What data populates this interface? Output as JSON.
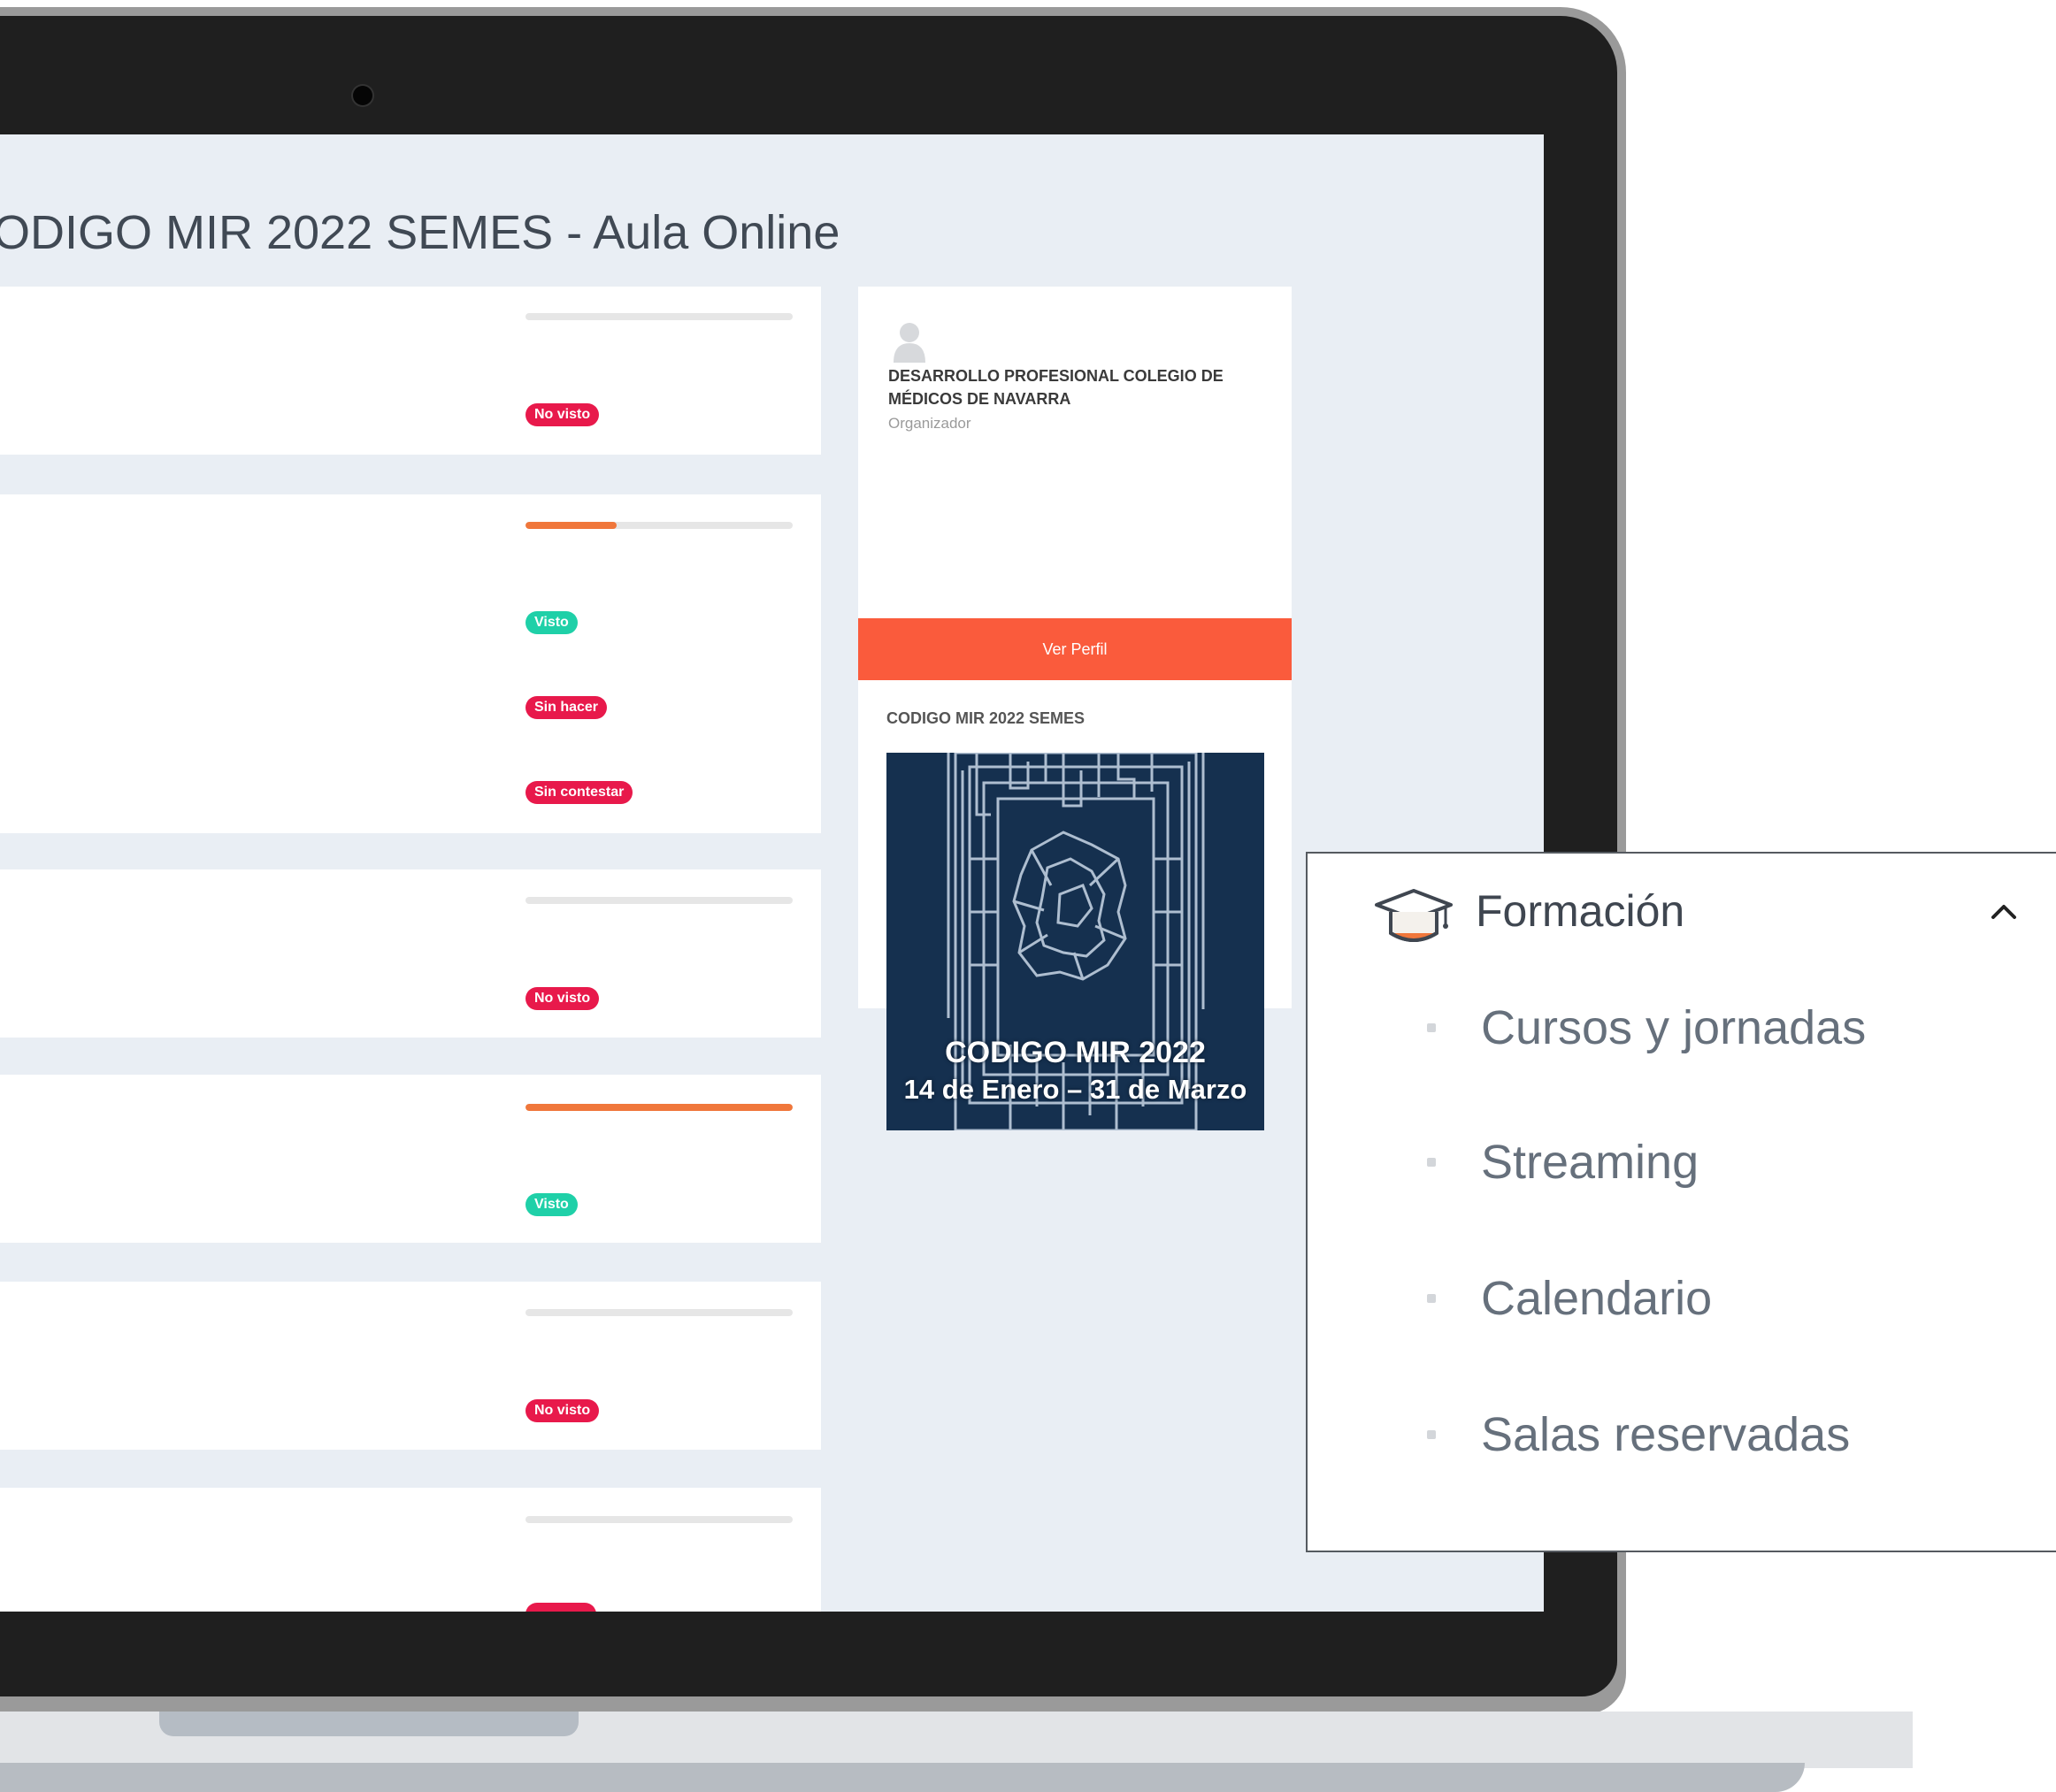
{
  "page": {
    "title": "ODIGO MIR 2022 SEMES - Aula Online"
  },
  "courses": [
    {
      "progress": 0,
      "badges": [
        {
          "label": "No visto",
          "color": "#e8194b"
        }
      ]
    },
    {
      "progress": 0.34,
      "badges": [
        {
          "label": "Visto",
          "color": "#1fd0a8"
        },
        {
          "label": "Sin hacer",
          "color": "#e8194b"
        },
        {
          "label": "Sin contestar",
          "color": "#e8194b"
        }
      ]
    },
    {
      "progress": 0,
      "badges": [
        {
          "label": "No visto",
          "color": "#e8194b"
        }
      ]
    },
    {
      "progress": 1.0,
      "badges": [
        {
          "label": "Visto",
          "color": "#1fd0a8"
        }
      ]
    },
    {
      "progress": 0,
      "badges": [
        {
          "label": "No visto",
          "color": "#e8194b"
        }
      ]
    },
    {
      "progress": 0,
      "badges": []
    }
  ],
  "organizer": {
    "name": "DESARROLLO PROFESIONAL COLEGIO DE MÉDICOS DE NAVARRA",
    "role": "Organizador",
    "button_label": "Ver Perfil",
    "button_color": "#fa5b3c",
    "course_label": "CODIGO MIR 2022 SEMES",
    "image_title": "CODIGO MIR 2022",
    "image_dates": "14 de Enero – 31 de Marzo"
  },
  "nav_menu": {
    "section_title": "Formación",
    "section_icon": "graduation-cap-icon",
    "toggle_icon": "chevron-up-icon",
    "items": [
      {
        "label": "Cursos y jornadas"
      },
      {
        "label": "Streaming"
      },
      {
        "label": "Calendario"
      },
      {
        "label": "Salas reservadas"
      }
    ]
  },
  "colors": {
    "accent": "#fa5b3c",
    "progress": "#f0773b",
    "badge_red": "#e8194b",
    "badge_green": "#1fd0a8",
    "screen_bg": "#e9eef4"
  }
}
